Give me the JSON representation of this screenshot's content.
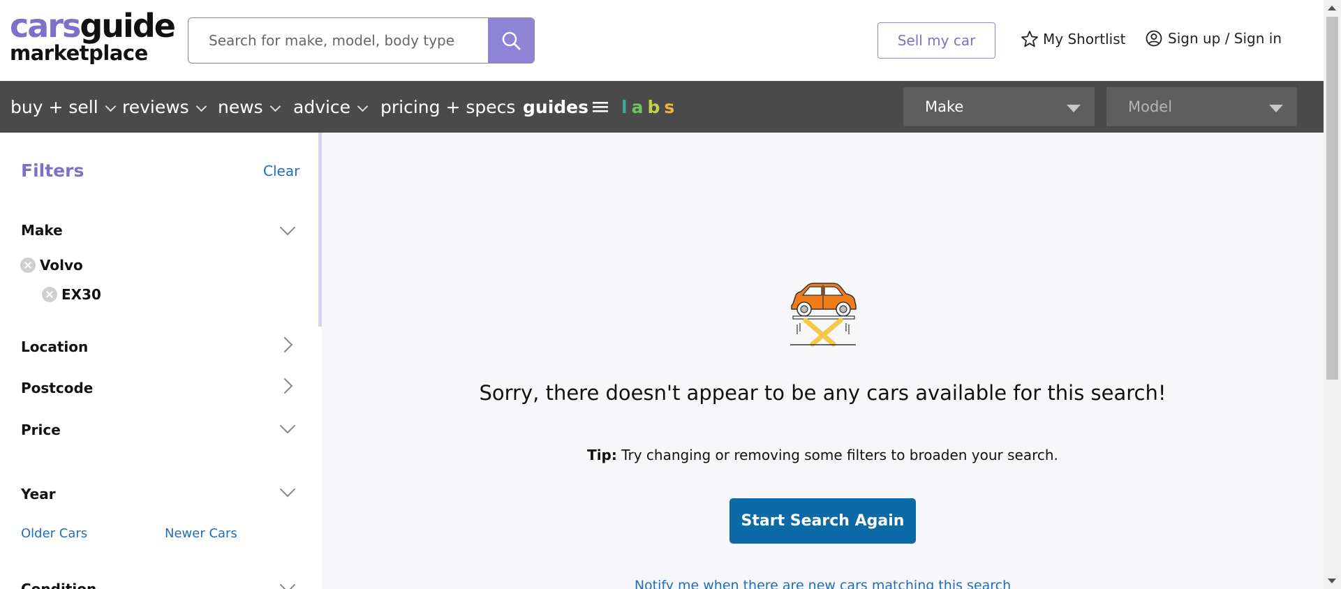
{
  "header": {
    "logo_top_cars": "cars",
    "logo_top_guide": "guide",
    "logo_bottom": "marketplace",
    "search_placeholder": "Search for make, model, body type",
    "sell_label": "Sell my car",
    "shortlist_label": "My Shortlist",
    "signin_label": "Sign up / Sign in"
  },
  "nav": {
    "items": [
      {
        "label": "buy + sell"
      },
      {
        "label": "reviews"
      },
      {
        "label": "news"
      },
      {
        "label": "advice"
      },
      {
        "label": "pricing + specs"
      },
      {
        "label": "guides"
      }
    ],
    "labs": {
      "l": "l",
      "a": "a",
      "b": "b",
      "s": "s"
    },
    "make_select": "Make",
    "model_select": "Model"
  },
  "filters": {
    "title": "Filters",
    "clear": "Clear",
    "make_label": "Make",
    "make_value": "Volvo",
    "model_value": "EX30",
    "location_label": "Location",
    "postcode_label": "Postcode",
    "price_label": "Price",
    "year_label": "Year",
    "older_cars": "Older Cars",
    "newer_cars": "Newer Cars",
    "condition_label": "Condition"
  },
  "main": {
    "empty_title": "Sorry, there doesn't appear to be any cars available for this search!",
    "tip_label": "Tip:",
    "tip_text": " Try changing or removing some filters to broaden your search.",
    "restart_label": "Start Search Again",
    "notify_text": "Notify me when there are new cars matching this search"
  },
  "colors": {
    "brand_purple": "#7d70c7",
    "nav_bg": "#4a4a4a",
    "link_blue": "#1f6fb8",
    "button_blue": "#0c6aa6",
    "car_orange": "#f07c1a",
    "lift_yellow": "#f5c84a"
  }
}
